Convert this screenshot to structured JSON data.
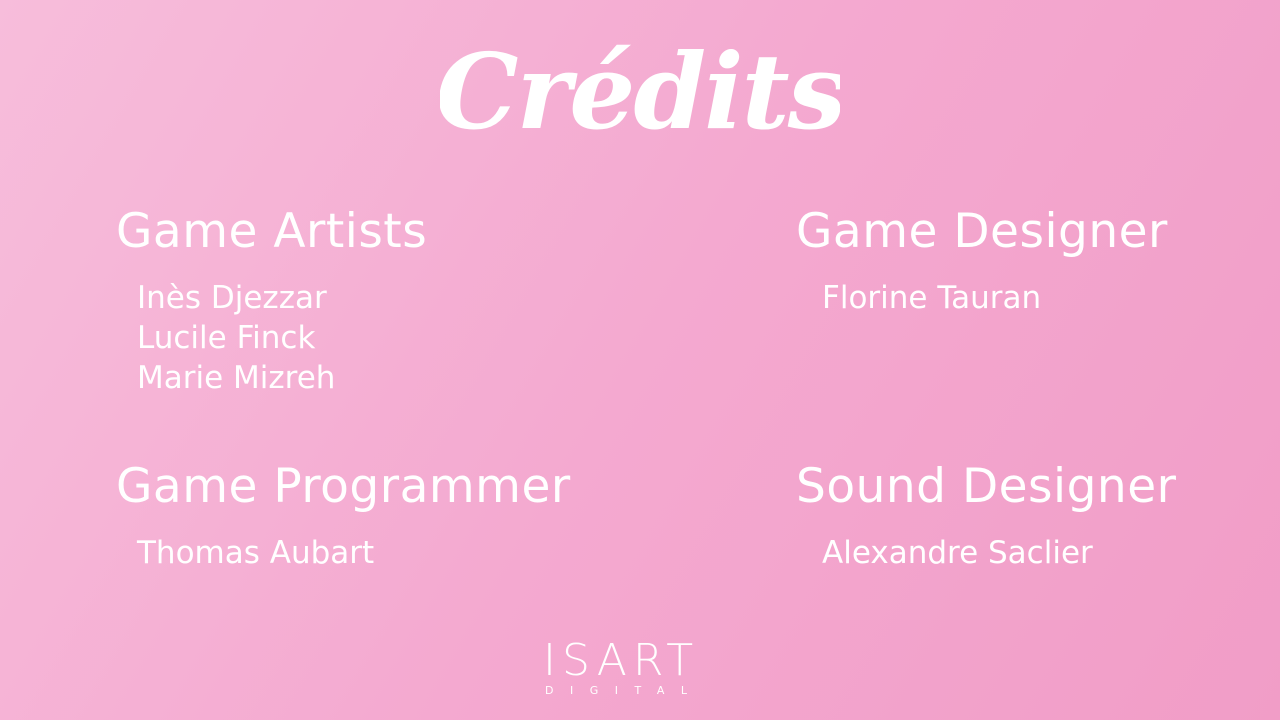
{
  "screen": {
    "title": "Crédits",
    "background_colors": [
      "#f7bddb",
      "#f4a9d0",
      "#f19dc7"
    ],
    "text_color": "#ffffff"
  },
  "sections": [
    {
      "heading": "Game Artists",
      "names": [
        "Inès Djezzar",
        "Lucile Finck",
        "Marie Mizreh"
      ]
    },
    {
      "heading": "Game Designer",
      "names": [
        "Florine Tauran"
      ]
    },
    {
      "heading": "Game Programmer",
      "names": [
        "Thomas Aubart"
      ]
    },
    {
      "heading": "Sound Designer",
      "names": [
        "Alexandre Saclier"
      ]
    }
  ],
  "logo": {
    "name": "ISART",
    "subtitle": "DIGITAL"
  }
}
